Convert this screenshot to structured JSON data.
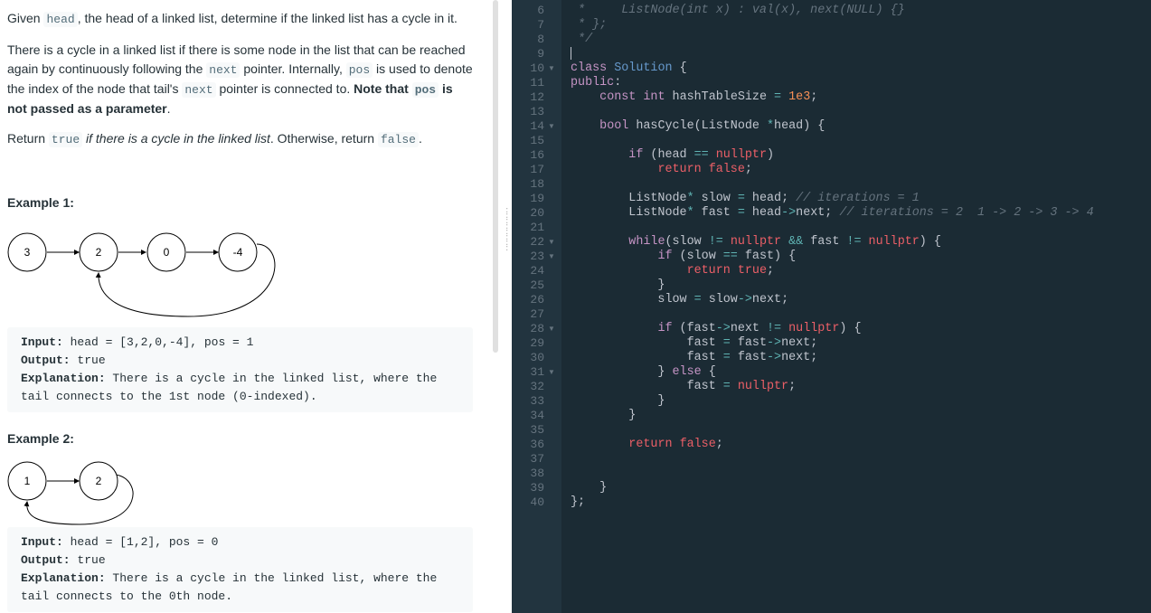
{
  "problem": {
    "intro": [
      "Given ",
      "head",
      ", the head of a linked list, determine if the linked list has a cycle in it."
    ],
    "desc": {
      "t1": "There is a cycle in a linked list if there is some node in the list that can be reached again by continuously following the ",
      "c1": "next",
      "t2": " pointer. Internally, ",
      "c2": "pos",
      "t3": " is used to denote the index of the node that tail's ",
      "c3": "next",
      "t4": " pointer is connected to. ",
      "b1": "Note that ",
      "c4": "pos",
      "b2": " is not passed as a parameter",
      "t5": "."
    },
    "ret": {
      "t1": "Return ",
      "c1": "true",
      "i1": " if there is a cycle in the linked list",
      "t2": ". Otherwise, return ",
      "c2": "false",
      "t3": "."
    }
  },
  "examples": [
    {
      "title": "Example 1:",
      "nodes": [
        "3",
        "2",
        "0",
        "-4"
      ],
      "input_label": "Input:",
      "input": " head = [3,2,0,-4], pos = 1",
      "output_label": "Output:",
      "output": " true",
      "expl_label": "Explanation:",
      "expl": " There is a cycle in the linked list, where the\ntail connects to the 1st node (0-indexed)."
    },
    {
      "title": "Example 2:",
      "nodes": [
        "1",
        "2"
      ],
      "input_label": "Input:",
      "input": " head = [1,2], pos = 0",
      "output_label": "Output:",
      "output": " true",
      "expl_label": "Explanation:",
      "expl": " There is a cycle in the linked list, where the\ntail connects to the 0th node."
    }
  ],
  "editor": {
    "lines": [
      {
        "n": "6",
        "fold": false,
        "tokens": [
          [
            "cm",
            " *     ListNode(int x) : val(x), next(NULL) {}"
          ]
        ]
      },
      {
        "n": "7",
        "fold": false,
        "tokens": [
          [
            "cm",
            " * };"
          ]
        ]
      },
      {
        "n": "8",
        "fold": false,
        "tokens": [
          [
            "cm",
            " */"
          ]
        ]
      },
      {
        "n": "9",
        "fold": false,
        "tokens": []
      },
      {
        "n": "10",
        "fold": true,
        "tokens": [
          [
            "kw",
            "class"
          ],
          [
            "",
            " "
          ],
          [
            "ty",
            "Solution"
          ],
          [
            "",
            " {"
          ]
        ]
      },
      {
        "n": "11",
        "fold": false,
        "tokens": [
          [
            "kw",
            "public"
          ],
          [
            "",
            ":"
          ]
        ]
      },
      {
        "n": "12",
        "fold": false,
        "tokens": [
          [
            "",
            "    "
          ],
          [
            "kw",
            "const"
          ],
          [
            "",
            " "
          ],
          [
            "kw",
            "int"
          ],
          [
            "",
            " hashTableSize "
          ],
          [
            "op",
            "="
          ],
          [
            "",
            " "
          ],
          [
            "nm",
            "1e3"
          ],
          [
            "",
            ";"
          ]
        ]
      },
      {
        "n": "13",
        "fold": false,
        "tokens": []
      },
      {
        "n": "14",
        "fold": true,
        "tokens": [
          [
            "",
            "    "
          ],
          [
            "kw",
            "bool"
          ],
          [
            "",
            " hasCycle(ListNode "
          ],
          [
            "op",
            "*"
          ],
          [
            "",
            "head) {"
          ]
        ]
      },
      {
        "n": "15",
        "fold": false,
        "tokens": []
      },
      {
        "n": "16",
        "fold": false,
        "tokens": [
          [
            "",
            "        "
          ],
          [
            "kw",
            "if"
          ],
          [
            "",
            " (head "
          ],
          [
            "op",
            "=="
          ],
          [
            "",
            " "
          ],
          [
            "pk",
            "nullptr"
          ],
          [
            "",
            ")"
          ]
        ]
      },
      {
        "n": "17",
        "fold": false,
        "tokens": [
          [
            "",
            "            "
          ],
          [
            "pk",
            "return"
          ],
          [
            "",
            " "
          ],
          [
            "pk",
            "false"
          ],
          [
            "",
            ";"
          ]
        ]
      },
      {
        "n": "18",
        "fold": false,
        "tokens": []
      },
      {
        "n": "19",
        "fold": false,
        "tokens": [
          [
            "",
            "        ListNode"
          ],
          [
            "op",
            "*"
          ],
          [
            "",
            " slow "
          ],
          [
            "op",
            "="
          ],
          [
            "",
            " head; "
          ],
          [
            "cm",
            "// iterations = 1"
          ]
        ]
      },
      {
        "n": "20",
        "fold": false,
        "tokens": [
          [
            "",
            "        ListNode"
          ],
          [
            "op",
            "*"
          ],
          [
            "",
            " fast "
          ],
          [
            "op",
            "="
          ],
          [
            "",
            " head"
          ],
          [
            "op",
            "->"
          ],
          [
            "",
            "next; "
          ],
          [
            "cm",
            "// iterations = 2  1 -> 2 -> 3 -> 4"
          ]
        ]
      },
      {
        "n": "21",
        "fold": false,
        "tokens": []
      },
      {
        "n": "22",
        "fold": true,
        "tokens": [
          [
            "",
            "        "
          ],
          [
            "kw",
            "while"
          ],
          [
            "",
            "(slow "
          ],
          [
            "op",
            "!="
          ],
          [
            "",
            " "
          ],
          [
            "pk",
            "nullptr"
          ],
          [
            "",
            " "
          ],
          [
            "op",
            "&&"
          ],
          [
            "",
            " fast "
          ],
          [
            "op",
            "!="
          ],
          [
            "",
            " "
          ],
          [
            "pk",
            "nullptr"
          ],
          [
            "",
            ") {"
          ]
        ]
      },
      {
        "n": "23",
        "fold": true,
        "tokens": [
          [
            "",
            "            "
          ],
          [
            "kw",
            "if"
          ],
          [
            "",
            " (slow "
          ],
          [
            "op",
            "=="
          ],
          [
            "",
            " fast) {"
          ]
        ]
      },
      {
        "n": "24",
        "fold": false,
        "tokens": [
          [
            "",
            "                "
          ],
          [
            "pk",
            "return"
          ],
          [
            "",
            " "
          ],
          [
            "pk",
            "true"
          ],
          [
            "",
            ";"
          ]
        ]
      },
      {
        "n": "25",
        "fold": false,
        "tokens": [
          [
            "",
            "            }"
          ]
        ]
      },
      {
        "n": "26",
        "fold": false,
        "tokens": [
          [
            "",
            "            slow "
          ],
          [
            "op",
            "="
          ],
          [
            "",
            " slow"
          ],
          [
            "op",
            "->"
          ],
          [
            "",
            "next;"
          ]
        ]
      },
      {
        "n": "27",
        "fold": false,
        "tokens": []
      },
      {
        "n": "28",
        "fold": true,
        "tokens": [
          [
            "",
            "            "
          ],
          [
            "kw",
            "if"
          ],
          [
            "",
            " (fast"
          ],
          [
            "op",
            "->"
          ],
          [
            "",
            "next "
          ],
          [
            "op",
            "!="
          ],
          [
            "",
            " "
          ],
          [
            "pk",
            "nullptr"
          ],
          [
            "",
            ") {"
          ]
        ]
      },
      {
        "n": "29",
        "fold": false,
        "tokens": [
          [
            "",
            "                fast "
          ],
          [
            "op",
            "="
          ],
          [
            "",
            " fast"
          ],
          [
            "op",
            "->"
          ],
          [
            "",
            "next;"
          ]
        ]
      },
      {
        "n": "30",
        "fold": false,
        "tokens": [
          [
            "",
            "                fast "
          ],
          [
            "op",
            "="
          ],
          [
            "",
            " fast"
          ],
          [
            "op",
            "->"
          ],
          [
            "",
            "next;"
          ]
        ]
      },
      {
        "n": "31",
        "fold": true,
        "tokens": [
          [
            "",
            "            } "
          ],
          [
            "kw",
            "else"
          ],
          [
            "",
            " {"
          ]
        ]
      },
      {
        "n": "32",
        "fold": false,
        "tokens": [
          [
            "",
            "                fast "
          ],
          [
            "op",
            "="
          ],
          [
            "",
            " "
          ],
          [
            "pk",
            "nullptr"
          ],
          [
            "",
            ";"
          ]
        ]
      },
      {
        "n": "33",
        "fold": false,
        "tokens": [
          [
            "",
            "            }"
          ]
        ]
      },
      {
        "n": "34",
        "fold": false,
        "tokens": [
          [
            "",
            "        }"
          ]
        ]
      },
      {
        "n": "35",
        "fold": false,
        "tokens": []
      },
      {
        "n": "36",
        "fold": false,
        "tokens": [
          [
            "",
            "        "
          ],
          [
            "pk",
            "return"
          ],
          [
            "",
            " "
          ],
          [
            "pk",
            "false"
          ],
          [
            "",
            ";"
          ]
        ]
      },
      {
        "n": "37",
        "fold": false,
        "tokens": []
      },
      {
        "n": "38",
        "fold": false,
        "tokens": []
      },
      {
        "n": "39",
        "fold": false,
        "tokens": [
          [
            "",
            "    }"
          ]
        ]
      },
      {
        "n": "40",
        "fold": false,
        "tokens": [
          [
            "",
            "};"
          ]
        ]
      }
    ]
  },
  "icons": {
    "fold": "fold-arrow-icon",
    "grip": "drag-handle-icon"
  }
}
